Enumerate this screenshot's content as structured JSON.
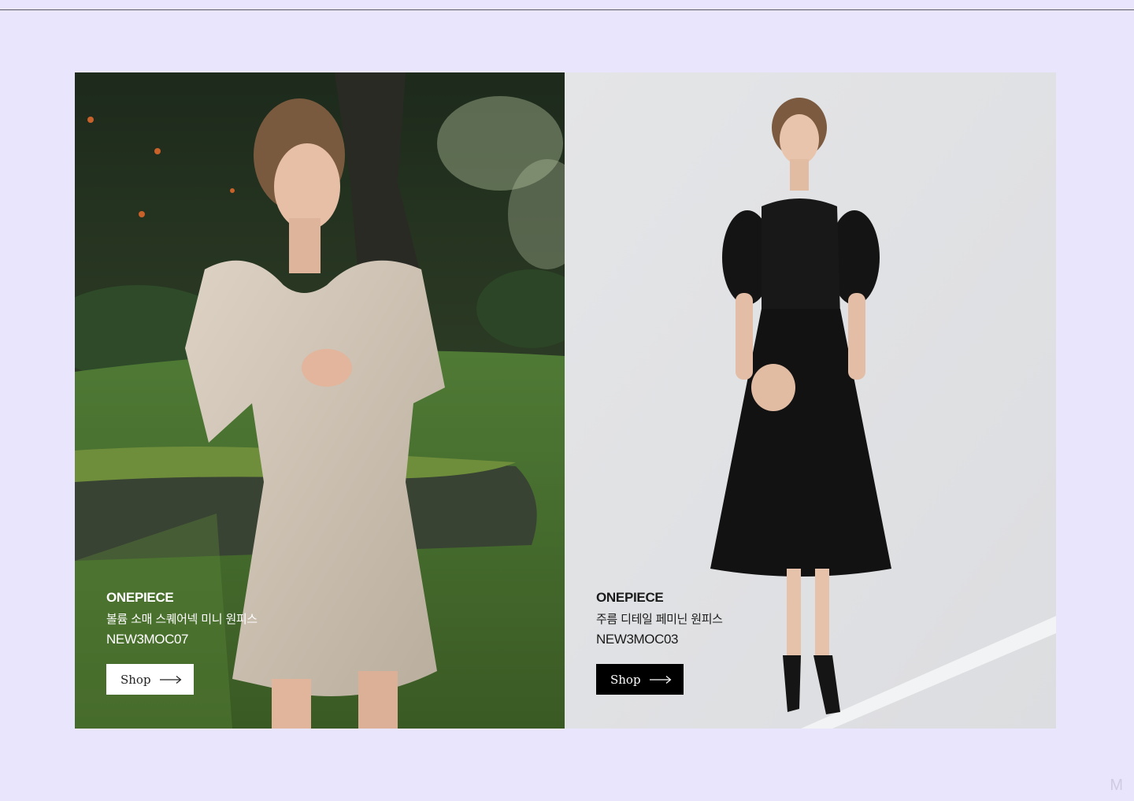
{
  "products": [
    {
      "category": "ONEPIECE",
      "name": "볼륨 소매 스퀘어넥 미니 원피스",
      "code": "NEW3MOC07",
      "button_label": "Shop",
      "button_style": "light"
    },
    {
      "category": "ONEPIECE",
      "name": "주름 디테일 페미닌 원피스",
      "code": "NEW3MOC03",
      "button_label": "Shop",
      "button_style": "dark"
    }
  ],
  "corner_mark": "M",
  "colors": {
    "page_background": "#e9e5fd",
    "dark_button": "#000000",
    "light_button": "#ffffff"
  }
}
